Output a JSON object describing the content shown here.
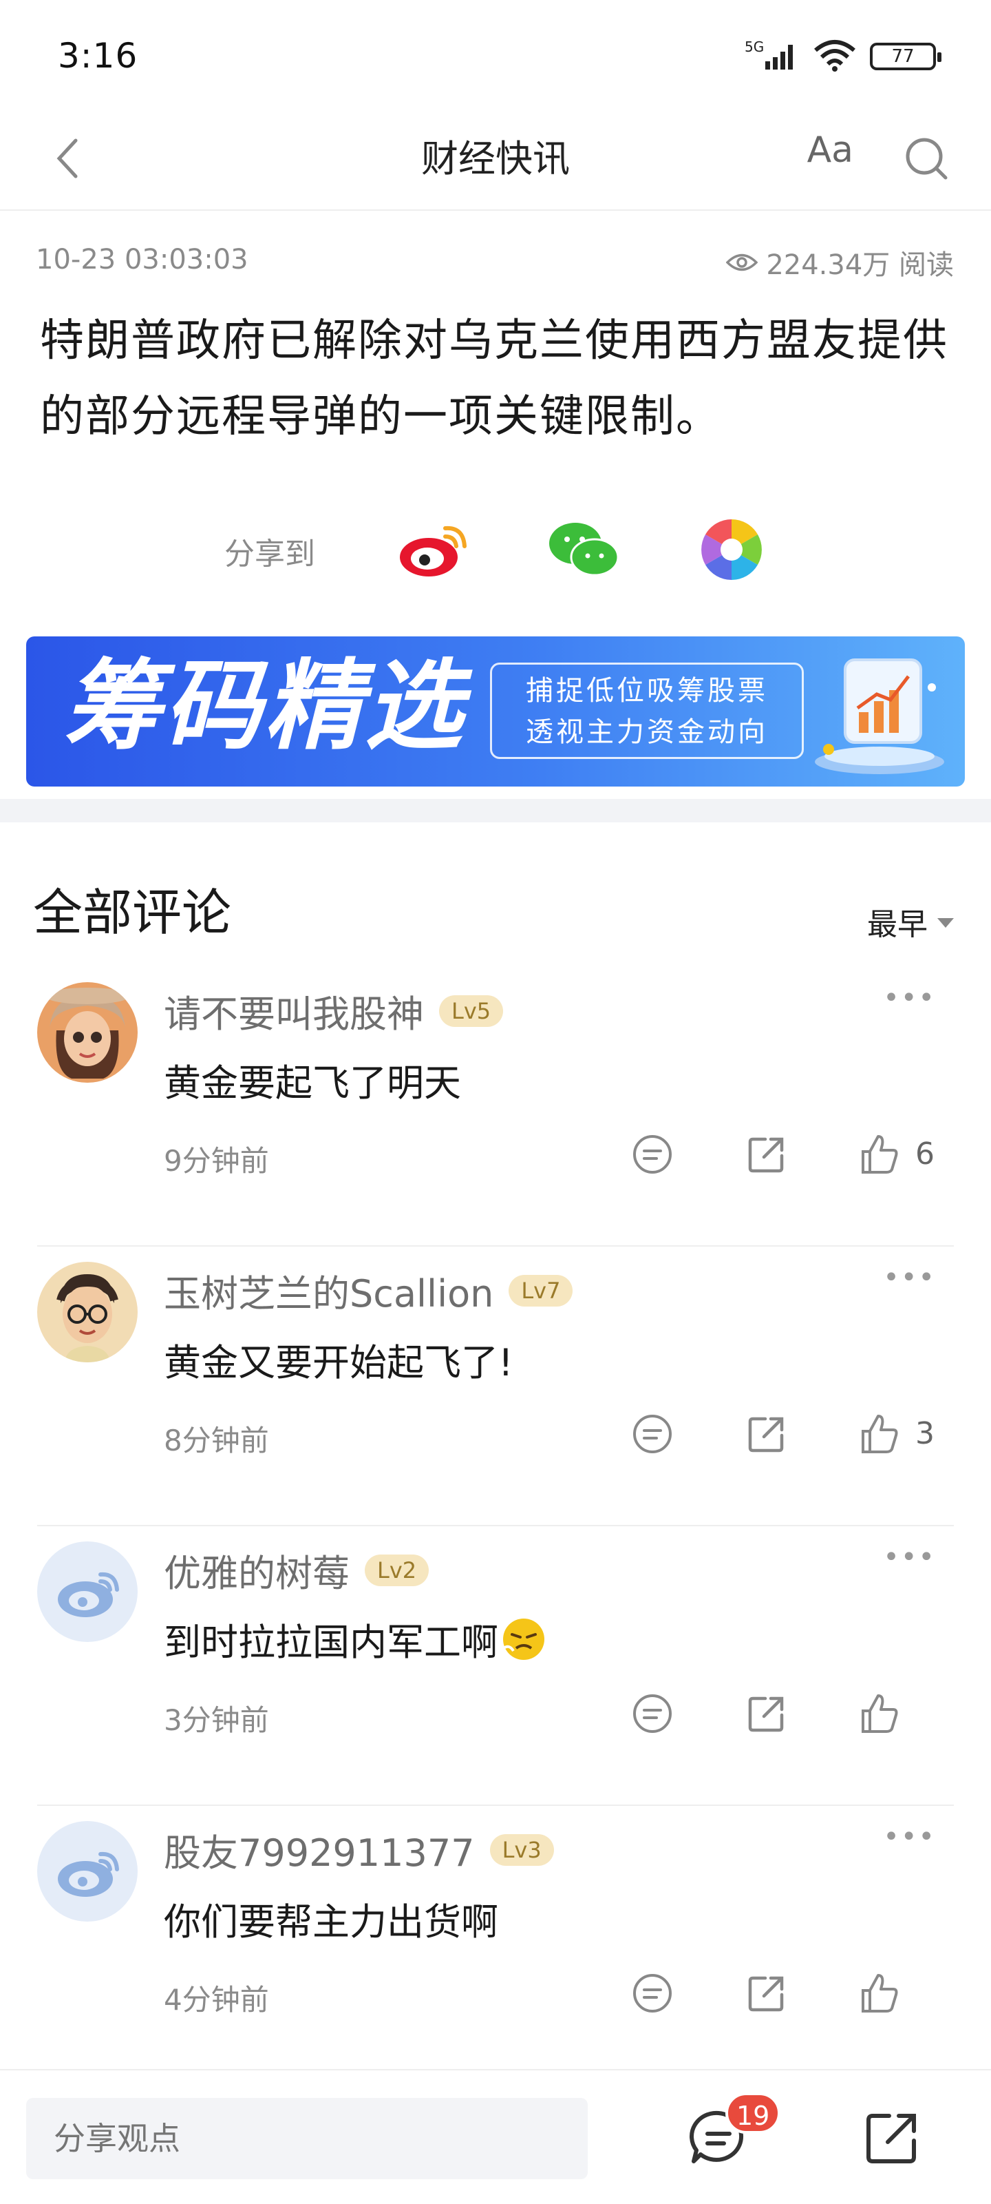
{
  "status_bar": {
    "time": "3:16",
    "network": "5G",
    "battery": "77"
  },
  "nav": {
    "title": "财经快讯",
    "font_label": "Aa"
  },
  "article": {
    "date": "10-23 03:03:03",
    "views": "224.34万 阅读",
    "headline": "特朗普政府已解除对乌克兰使用西方盟友提供的部分远程导弹的一项关键限制。"
  },
  "share": {
    "label": "分享到",
    "targets": [
      "weibo-icon",
      "wechat-icon",
      "moments-icon"
    ]
  },
  "banner": {
    "title": "筹码精选",
    "line1": "捕捉低位吸筹股票",
    "line2": "透视主力资金动向"
  },
  "comments_section": {
    "title": "全部评论",
    "sort_label": "最早"
  },
  "comments": [
    {
      "name": "请不要叫我股神",
      "level": "Lv5",
      "text": "黄金要起飞了明天",
      "time": "9分钟前",
      "likes": "6"
    },
    {
      "name": "玉树芝兰的Scallion",
      "level": "Lv7",
      "text": "黄金又要开始起飞了!",
      "time": "8分钟前",
      "likes": "3"
    },
    {
      "name": "优雅的树莓",
      "level": "Lv2",
      "text": "到时拉拉国内军工啊",
      "time": "3分钟前",
      "likes": ""
    },
    {
      "name": "股友7992911377",
      "level": "Lv3",
      "text": "你们要帮主力出货啊",
      "time": "4分钟前",
      "likes": ""
    }
  ],
  "bottom_bar": {
    "placeholder": "分享观点",
    "comment_count": "19"
  },
  "colors": {
    "accent_blue": "#3f7ff3",
    "badge_red": "#e84a3c",
    "level_bg": "#f6e6bf"
  }
}
